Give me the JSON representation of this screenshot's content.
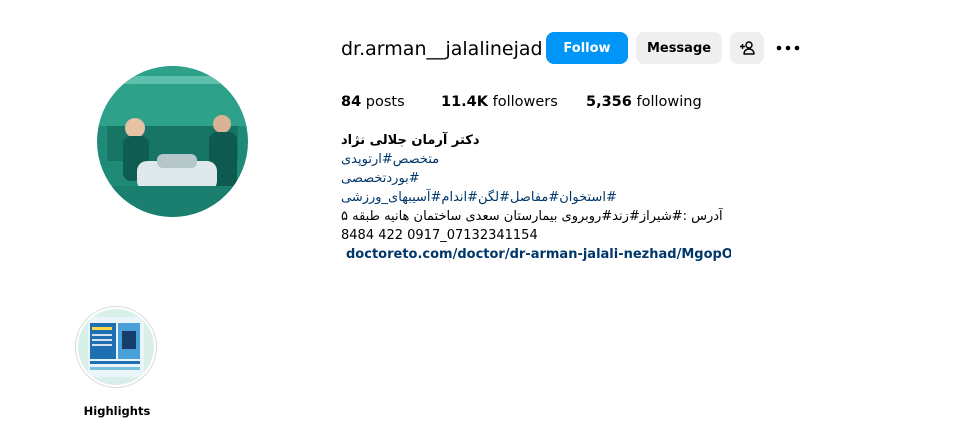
{
  "profile": {
    "username": "dr.arman__jalalinejad",
    "follow_label": "Follow",
    "message_label": "Message",
    "add_user_icon": "add-user-icon",
    "more_icon": "more-options-icon"
  },
  "stats": {
    "posts_count": "84",
    "posts_label": "posts",
    "followers_count": "11.4K",
    "followers_label": "followers",
    "following_count": "5,356",
    "following_label": "following"
  },
  "bio": {
    "full_name": "دکتر آرمان جلالی نژاد",
    "lines": [
      "متخصص#ارتوپدی",
      "#بوردتخصصی",
      "#استخوان#مفاصل#لگن#اندام#آسیبهای_ورزشی",
      "آدرس :#شیراز#زند#روبروی بیمارستان سعدی ساختمان هانیه طبقه ۵",
      "8484 422 0917_07132341154"
    ],
    "link_text": "doctoreto.com/doctor/dr-arman-jalali-nezhad/MgopOn",
    "link_icon": "link-icon"
  },
  "highlights": [
    {
      "label": "Highlights"
    }
  ],
  "colors": {
    "primary_button": "#0095f6",
    "secondary_button": "#efefef",
    "link": "#00376b"
  }
}
